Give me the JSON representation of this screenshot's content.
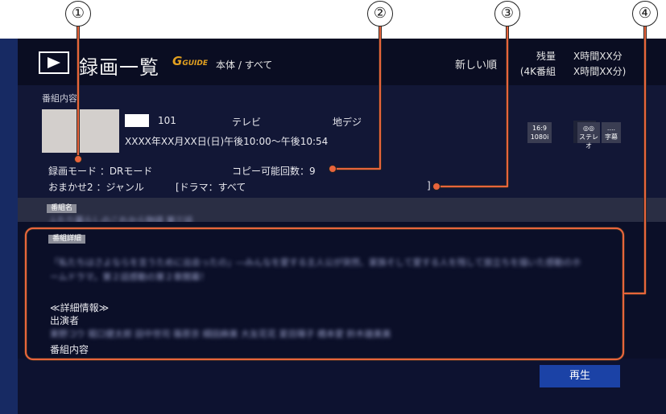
{
  "callouts": [
    "①",
    "②",
    "③",
    "④"
  ],
  "header": {
    "title": "録画一覧",
    "guide_logo": "G",
    "guide_logo_suffix": "GUIDE",
    "breadcrumb": "本体 / すべて",
    "sort": "新しい順",
    "remaining_label": "残量",
    "remaining_value": "X時間XX分",
    "remaining_4k_label": "(4K番組",
    "remaining_4k_value": "X時間XX分)"
  },
  "info": {
    "section_label": "番組内容",
    "channel_number": "101",
    "channel_type": "テレビ",
    "broadcast": "地デジ",
    "datetime": "XXXX年XX月XX日(日)午後10:00〜午後10:54",
    "record_mode": "録画モード ：DRモード",
    "copy_count": "コピー可能回数：9",
    "omakase": "おまかせ2 ：ジャンル",
    "genre": "[ドラマ：すべて",
    "genre_end": "]",
    "badges": {
      "aspect": "16:9",
      "resolution": "1080i",
      "stereo_top": "◎◎",
      "stereo": "ステレオ",
      "subtitle_top": "....",
      "subtitle": "字幕"
    }
  },
  "program": {
    "tag": "番組名",
    "name_blur": "ふたり暮らしのこれから物語 第三話"
  },
  "detail": {
    "tag": "番組詳細",
    "line1_blur": "「私たちはさよならを言うために出会ったの」―みんなを愛する主人公が突然、家族そして愛する人を残して旅立ちを描いた感動のホ",
    "line2_blur": "ームドラマ。第２話感動の第２章開幕！",
    "detail_heading": "≪詳細情報≫",
    "cast_label": "出演者",
    "cast_blur": "東野コウ 堀口健太郎 田中世司 篠原京 細田麻美 大友花花 夏目陽子 橋本愛 鈴木雄美美",
    "content_label": "番組内容"
  },
  "footer": {
    "play": "再生"
  },
  "colors": {
    "accent": "#e8643c",
    "play_button": "#1b42a6",
    "logo": "#e2a020"
  }
}
